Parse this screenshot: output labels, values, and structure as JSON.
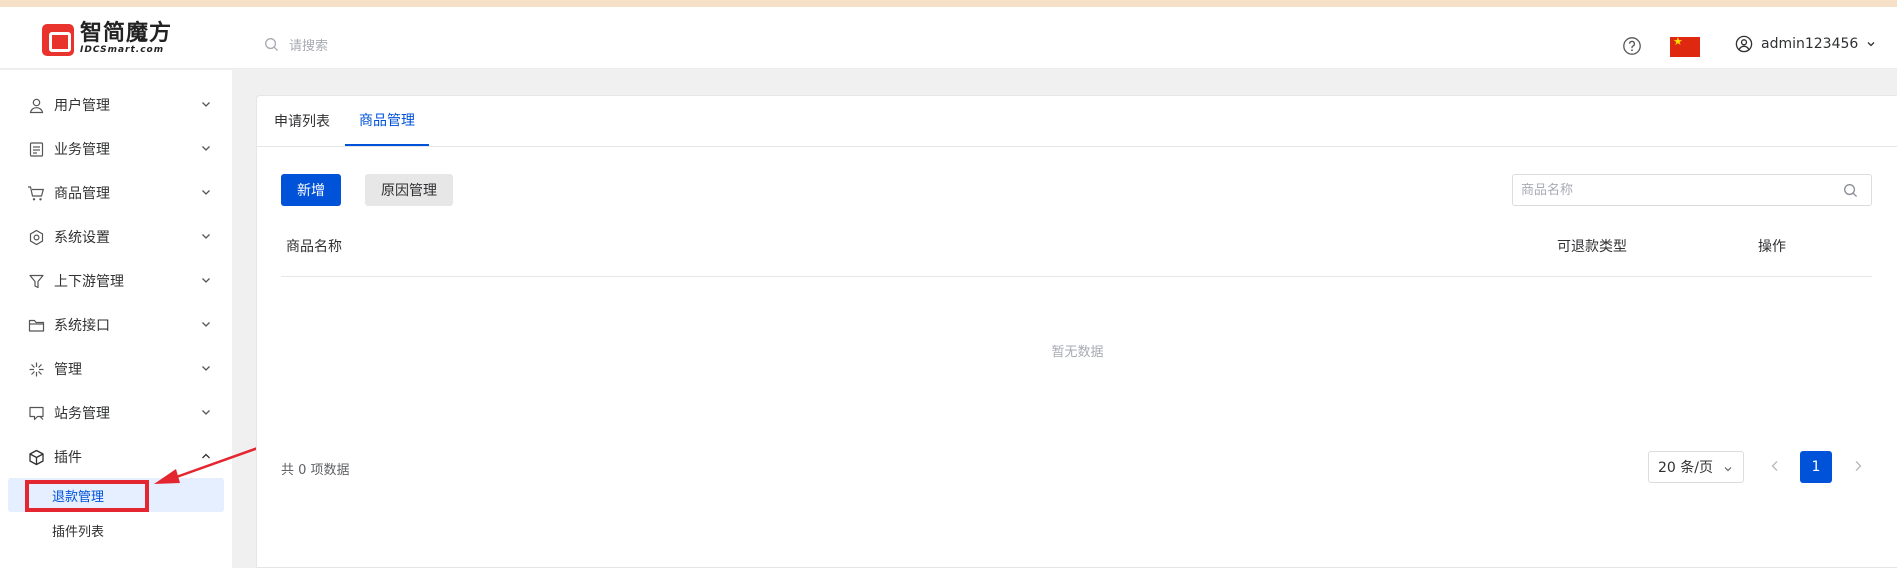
{
  "brand": {
    "name_cn": "智简魔方",
    "name_en": "IDCSmart.com",
    "logo_color": "#e9332d"
  },
  "header": {
    "search_placeholder": "请搜索",
    "help_icon": "question-circle-icon",
    "language_flag": "china-flag",
    "username": "admin123456"
  },
  "sidebar": {
    "items": [
      {
        "label": "用户管理",
        "icon": "user-icon"
      },
      {
        "label": "业务管理",
        "icon": "document-icon"
      },
      {
        "label": "商品管理",
        "icon": "cart-icon"
      },
      {
        "label": "系统设置",
        "icon": "settings-icon"
      },
      {
        "label": "上下游管理",
        "icon": "filter-icon"
      },
      {
        "label": "系统接口",
        "icon": "folder-icon"
      },
      {
        "label": "管理",
        "icon": "asterisk-icon"
      },
      {
        "label": "站务管理",
        "icon": "chat-icon"
      },
      {
        "label": "插件",
        "icon": "box-icon"
      }
    ],
    "plugin_subitems": [
      {
        "label": "退款管理",
        "active": true
      },
      {
        "label": "插件列表",
        "active": false
      }
    ]
  },
  "tabs": [
    {
      "label": "申请列表",
      "active": false
    },
    {
      "label": "商品管理",
      "active": true
    }
  ],
  "toolbar": {
    "add_label": "新增",
    "reason_label": "原因管理",
    "product_search_placeholder": "商品名称"
  },
  "table": {
    "columns": [
      "商品名称",
      "可退款类型",
      "操作"
    ],
    "rows": [],
    "empty_text": "暂无数据"
  },
  "pagination": {
    "total_text": "共 0 项数据",
    "page_size_label": "20 条/页",
    "current_page": "1"
  },
  "colors": {
    "primary": "#0052d9",
    "active_bg": "#e6efff",
    "annotation_red": "#e3262f"
  }
}
